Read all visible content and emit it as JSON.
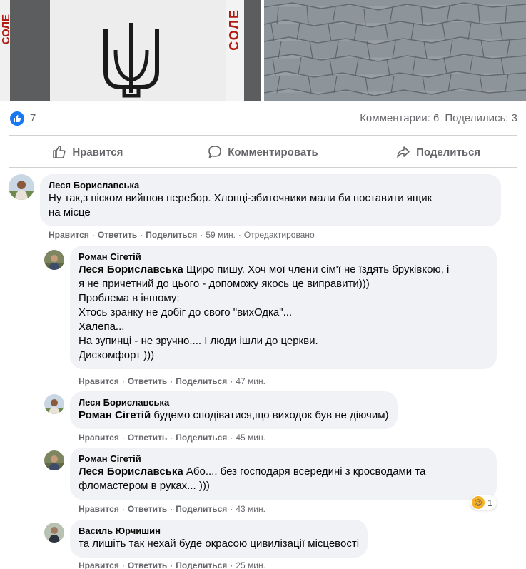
{
  "post": {
    "photo_left_sign_text": "СОЛЕ",
    "photo_left_sign_text_right": "СОЛЕ",
    "like_count": "7",
    "comments_count": "Комментарии: 6",
    "shares_count": "Поделились: 3",
    "actions": {
      "like": "Нравится",
      "comment": "Комментировать",
      "share": "Поделиться"
    }
  },
  "comments": [
    {
      "author": "Леся Бориславська",
      "mention": "",
      "lines": [
        "Ну так,з піском вийшов перебор. Хлопці-збиточники мали би поставити ящик",
        "на місце"
      ],
      "meta": {
        "like": "Нравится",
        "reply": "Ответить",
        "share": "Поделиться",
        "time": "59 мин.",
        "edited": "Отредактировано"
      }
    },
    {
      "author": "Роман Сігетій",
      "mention": "Леся Бориславська",
      "first_line_rest": "Щиро пишу. Хоч мої члени сім'ї не їздять бруківкою, і",
      "lines": [
        "я не причетний до цього - допоможу якось це виправити)))",
        "Проблема в іншому:",
        "Хтось зранку не добіг до свого \"вихОдка\"...",
        "Халепа...",
        "На зупинці - не зручно.... І люди ішли до церкви.",
        "Дискомфорт )))"
      ],
      "meta": {
        "like": "Нравится",
        "reply": "Ответить",
        "share": "Поделиться",
        "time": "47 мин."
      }
    },
    {
      "author": "Леся Бориславська",
      "mention": "Роман Сігетій",
      "first_line_rest": "будемо сподіватися,що виходок був не діючим)",
      "meta": {
        "like": "Нравится",
        "reply": "Ответить",
        "share": "Поделиться",
        "time": "45 мин."
      }
    },
    {
      "author": "Роман Сігетій",
      "mention": "Леся Бориславська",
      "first_line_rest": "Або.... без господаря всередині з кросводами та",
      "lines": [
        "фломастером в руках... )))"
      ],
      "reaction_count": "1",
      "meta": {
        "like": "Нравится",
        "reply": "Ответить",
        "share": "Поделиться",
        "time": "43 мин."
      }
    },
    {
      "author": "Василь Юрчишин",
      "mention": "",
      "lines": [
        "та лишіть так нехай буде окрасою цивилізації місцевості"
      ],
      "meta": {
        "like": "Нравится",
        "reply": "Ответить",
        "share": "Поделиться",
        "time": "25 мин."
      }
    }
  ],
  "colors": {
    "brand_blue": "#1877f2",
    "bubble_bg": "#f0f2f5",
    "secondary_text": "#65676b",
    "sign_red": "#b01b12"
  },
  "icons": {
    "like_badge": "thumbs-up-icon",
    "like_action": "thumbs-up-outline-icon",
    "comment_action": "speech-bubble-icon",
    "share_action": "share-arrow-icon",
    "reaction": "haha-emoji-icon"
  }
}
